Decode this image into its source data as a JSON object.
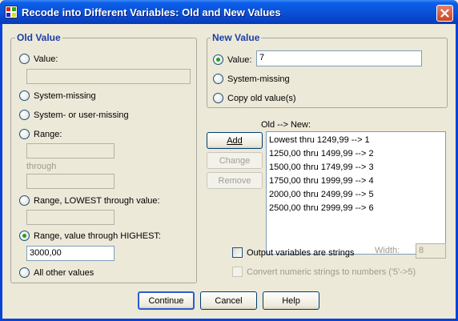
{
  "window": {
    "title": "Recode into Different Variables: Old and New Values"
  },
  "old_value": {
    "group_label": "Old Value",
    "value_label": "Value:",
    "value_text": "",
    "system_missing_label": "System-missing",
    "system_or_user_missing_label": "System- or user-missing",
    "range_label": "Range:",
    "range_low": "",
    "through_label": "through",
    "range_high": "",
    "range_lowest_label": "Range, LOWEST through value:",
    "range_lowest_value": "",
    "range_highest_label": "Range, value through HIGHEST:",
    "range_highest_value": "3000,00",
    "all_other_label": "All other values",
    "selected": "range_highest"
  },
  "new_value": {
    "group_label": "New Value",
    "value_label": "Value:",
    "value_text": "7",
    "system_missing_label": "System-missing",
    "copy_old_label": "Copy old value(s)",
    "selected": "value"
  },
  "mapping": {
    "list_label": "Old --> New:",
    "items": [
      "Lowest thru 1249,99 --> 1",
      "1250,00 thru 1499,99 --> 2",
      "1500,00 thru 1749,99 --> 3",
      "1750,00 thru 1999,99 --> 4",
      "2000,00 thru 2499,99 --> 5",
      "2500,00 thru 2999,99 --> 6"
    ],
    "add_label": "Add",
    "change_label": "Change",
    "remove_label": "Remove"
  },
  "options": {
    "output_strings_label": "Output variables are strings",
    "output_strings_checked": false,
    "width_label": "Width:",
    "width_value": "8",
    "convert_label": "Convert numeric strings to numbers ('5'->5)",
    "convert_checked": false
  },
  "buttons": {
    "continue_label": "Continue",
    "cancel_label": "Cancel",
    "help_label": "Help"
  },
  "colors": {
    "titlebar": "#0a52d9",
    "group_label": "#1c3fa4",
    "radio_dot": "#21a121",
    "close_button": "#c9461f"
  }
}
